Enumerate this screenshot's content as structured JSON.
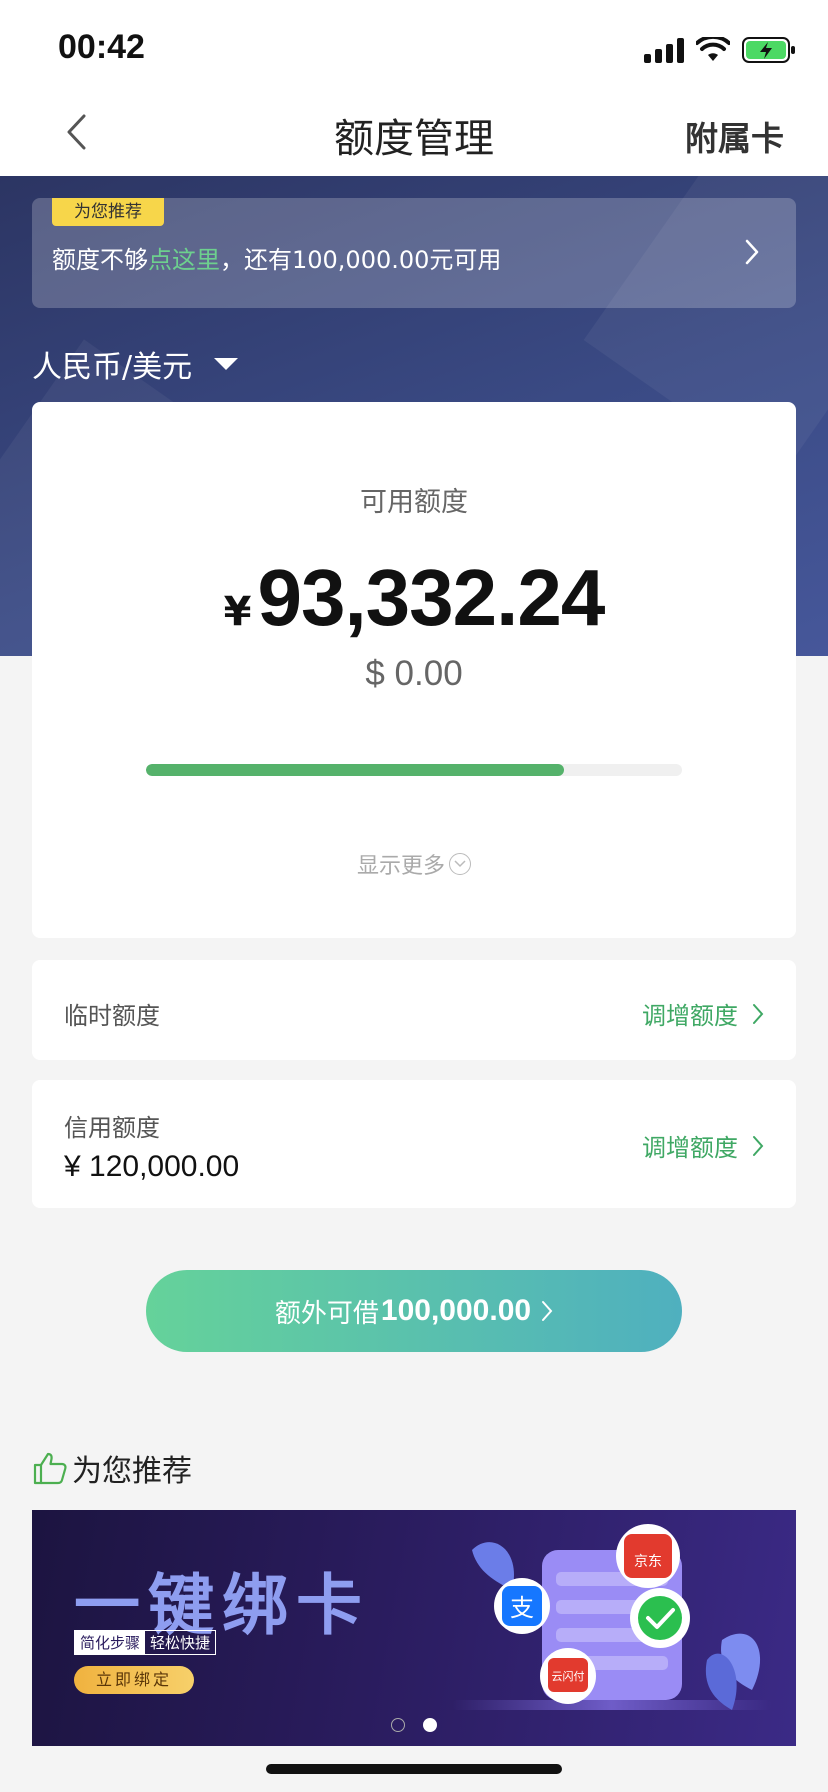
{
  "status_bar": {
    "time": "00:42"
  },
  "nav": {
    "title": "额度管理",
    "right_label": "附属卡"
  },
  "promo": {
    "tag": "为您推荐",
    "text_before": "额度不够",
    "link_text": "点这里",
    "text_after": "，还有100,000.00元可用"
  },
  "currency": {
    "label": "人民币/美元"
  },
  "available": {
    "label": "可用额度",
    "cny_symbol": "¥",
    "cny_amount": "93,332.24",
    "usd_amount": "$ 0.00",
    "usage_fraction": 0.78,
    "show_more": "显示更多"
  },
  "temp_limit": {
    "label": "临时额度",
    "action": "调增额度"
  },
  "credit_limit": {
    "label": "信用额度",
    "value": "¥ 120,000.00",
    "action": "调增额度"
  },
  "extra_borrow": {
    "prefix": "额外可借",
    "amount": "100,000.00"
  },
  "recommend": {
    "title": "为您推荐",
    "banner": {
      "headline": "一键绑卡",
      "tag1": "简化步骤",
      "tag2": "轻松快捷",
      "cta": "立即绑定",
      "badge_jd": "京东",
      "badge_alipay": "支",
      "badge_unionpay": "云闪付"
    },
    "carousel_active_index": 1
  },
  "colors": {
    "accent_green": "#3fa864",
    "progress": "#55b26b",
    "hero": "#3a4a84"
  }
}
